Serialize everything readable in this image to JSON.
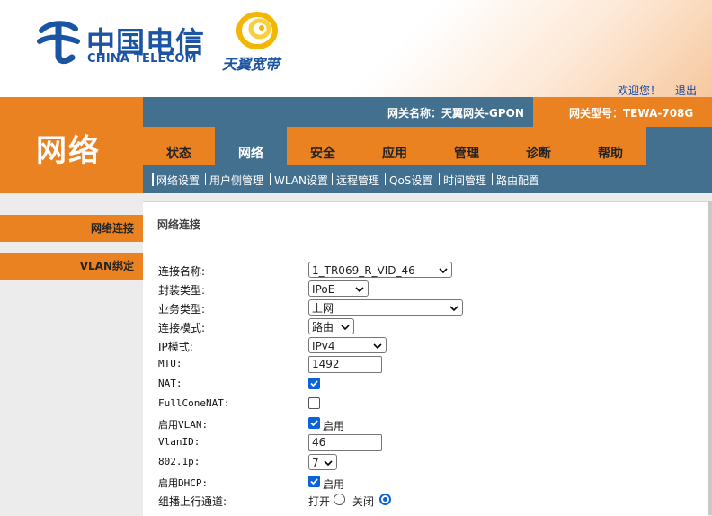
{
  "brand": {
    "telecom_cn": "中国电信",
    "telecom_en": "CHINA TELECOM",
    "tianyi": "天翼宽带",
    "telecom_color": "#1a54a3",
    "tianyi_color": "#f2b705"
  },
  "header": {
    "welcome": "欢迎您！",
    "logout": "退出",
    "gateway_name": "网关名称：天翼网关-GPON",
    "gateway_model": "网关型号：TEWA-708G"
  },
  "section_title": "网络",
  "tabs": [
    {
      "label": "状态",
      "active": false
    },
    {
      "label": "网络",
      "active": true
    },
    {
      "label": "安全",
      "active": false
    },
    {
      "label": "应用",
      "active": false
    },
    {
      "label": "管理",
      "active": false
    },
    {
      "label": "诊断",
      "active": false
    },
    {
      "label": "帮助",
      "active": false
    }
  ],
  "subnav": [
    "网络设置",
    "用户侧管理",
    "WLAN设置",
    "远程管理",
    "QoS设置",
    "时间管理",
    "路由配置"
  ],
  "sidebar": [
    "网络连接",
    "VLAN绑定"
  ],
  "content": {
    "title": "网络连接",
    "fields": {
      "conn_name": {
        "label": "连接名称:",
        "value": "1_TR069_R_VID_46"
      },
      "encap": {
        "label": "封装类型:",
        "value": "IPoE"
      },
      "service": {
        "label": "业务类型:",
        "value": "上网"
      },
      "mode": {
        "label": "连接模式:",
        "value": "路由"
      },
      "ipmode": {
        "label": "IP模式:",
        "value": "IPv4"
      },
      "mtu": {
        "label": "MTU:",
        "value": "1492"
      },
      "nat": {
        "label": "NAT:",
        "checked": true
      },
      "fullcone": {
        "label": "FullConeNAT:",
        "checked": false
      },
      "vlan": {
        "label": "启用VLAN:",
        "checked": true,
        "text": "启用"
      },
      "vlanid": {
        "label": "VlanID:",
        "value": "46"
      },
      "p8021": {
        "label": "802.1p:",
        "value": "7"
      },
      "dhcp": {
        "label": "启用DHCP:",
        "checked": true,
        "text": "启用"
      },
      "multicast": {
        "label": "组播上行通道:",
        "open": "打开",
        "close": "关闭",
        "selected": "关闭"
      }
    }
  },
  "colors": {
    "orange": "#ea8222",
    "steel_blue": "#43708f",
    "link_blue": "#1747a6",
    "checkbox_blue": "#0a63d7"
  }
}
